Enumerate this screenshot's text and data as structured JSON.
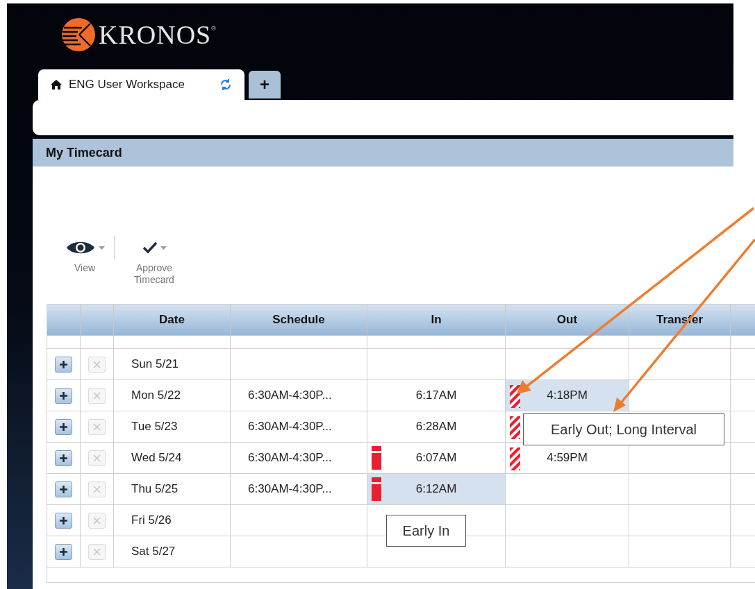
{
  "logo": {
    "wordmark": "KRONOS",
    "registered": "®"
  },
  "tabs": [
    {
      "label": "ENG User Workspace",
      "selected": true
    },
    {
      "label": "+",
      "selected": false
    }
  ],
  "panel": {
    "title": "My Timecard"
  },
  "toolbar": [
    {
      "kind": "view",
      "label": "View"
    },
    {
      "kind": "approve",
      "label": "Approve Timecard"
    }
  ],
  "table": {
    "columns": [
      "Date",
      "Schedule",
      "In",
      "Out",
      "Transfer"
    ],
    "rows": [
      {
        "date": "Sun 5/21",
        "in_exception": false,
        "in_highlighted": false,
        "out_exception": false,
        "out_highlighted": false
      },
      {
        "date": "Mon 5/22",
        "schedule": "6:30AM-4:30P...",
        "in": "6:17AM",
        "in_exception": false,
        "in_highlighted": false,
        "out": "4:18PM",
        "out_exception": true,
        "out_highlighted": true
      },
      {
        "date": "Tue 5/23",
        "schedule": "6:30AM-4:30P...",
        "in": "6:28AM",
        "in_exception": false,
        "in_highlighted": false,
        "out_exception": true,
        "out_highlighted": false
      },
      {
        "date": "Wed 5/24",
        "schedule": "6:30AM-4:30P...",
        "in": "6:07AM",
        "in_exception": true,
        "in_highlighted": false,
        "out": "4:59PM",
        "out_exception": true,
        "out_highlighted": false
      },
      {
        "date": "Thu 5/25",
        "schedule": "6:30AM-4:30P...",
        "in": "6:12AM",
        "in_exception": true,
        "in_highlighted": true,
        "out_exception": false,
        "out_highlighted": false
      },
      {
        "date": "Fri 5/26",
        "in_exception": false,
        "in_highlighted": false,
        "out_exception": false,
        "out_highlighted": false
      },
      {
        "date": "Sat 5/27",
        "in_exception": false,
        "in_highlighted": false,
        "out_exception": false,
        "out_highlighted": false
      }
    ]
  },
  "tooltips": [
    {
      "text": "Early Out; Long Interval"
    },
    {
      "text": "Early In"
    }
  ]
}
